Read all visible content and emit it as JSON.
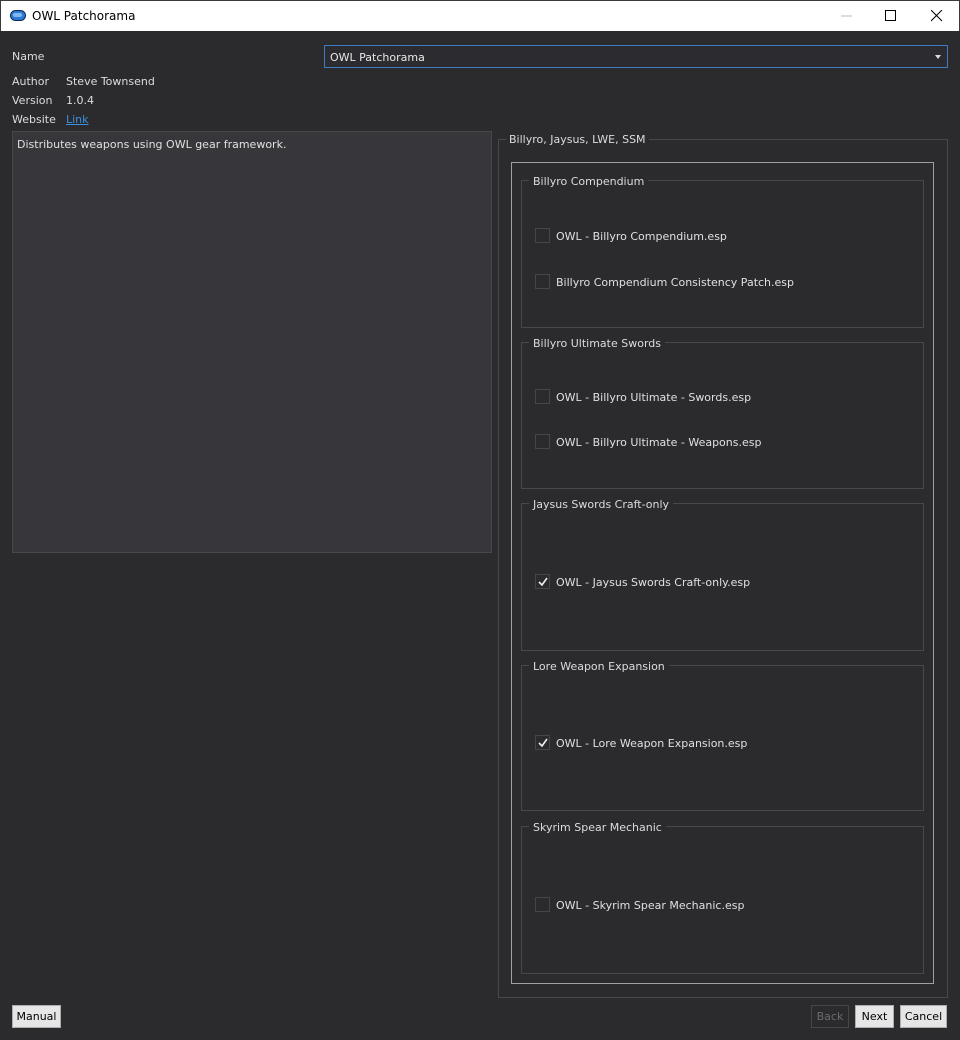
{
  "window": {
    "title": "OWL Patchorama",
    "icon": "app-pill-icon",
    "controls": [
      "minimize-icon",
      "maximize-icon",
      "close-icon"
    ]
  },
  "header": {
    "name_label": "Name",
    "name_value": "OWL Patchorama",
    "author_label": "Author",
    "author_value": "Steve Townsend",
    "version_label": "Version",
    "version_value": "1.0.4",
    "website_label": "Website",
    "website_link": "Link"
  },
  "description": "Distributes weapons using OWL gear framework.",
  "options": {
    "title": "Billyro, Jaysus, LWE, SSM",
    "groups": [
      {
        "title": "Billyro Compendium",
        "items": [
          {
            "label": "OWL - Billyro Compendium.esp",
            "checked": false
          },
          {
            "label": "Billyro Compendium Consistency Patch.esp",
            "checked": false
          }
        ]
      },
      {
        "title": "Billyro Ultimate Swords",
        "items": [
          {
            "label": "OWL - Billyro Ultimate - Swords.esp",
            "checked": false
          },
          {
            "label": "OWL - Billyro Ultimate - Weapons.esp",
            "checked": false
          }
        ]
      },
      {
        "title": "Jaysus Swords Craft-only",
        "items": [
          {
            "label": "OWL - Jaysus Swords Craft-only.esp",
            "checked": true
          }
        ]
      },
      {
        "title": "Lore Weapon Expansion",
        "items": [
          {
            "label": "OWL - Lore Weapon Expansion.esp",
            "checked": true
          }
        ]
      },
      {
        "title": "Skyrim Spear Mechanic",
        "items": [
          {
            "label": "OWL - Skyrim Spear Mechanic.esp",
            "checked": false
          }
        ]
      }
    ]
  },
  "footer": {
    "manual": "Manual",
    "back": "Back",
    "next": "Next",
    "cancel": "Cancel"
  },
  "colors": {
    "background": "#2b2b2e",
    "accent": "#3d7ac2",
    "link": "#3a8fde"
  }
}
